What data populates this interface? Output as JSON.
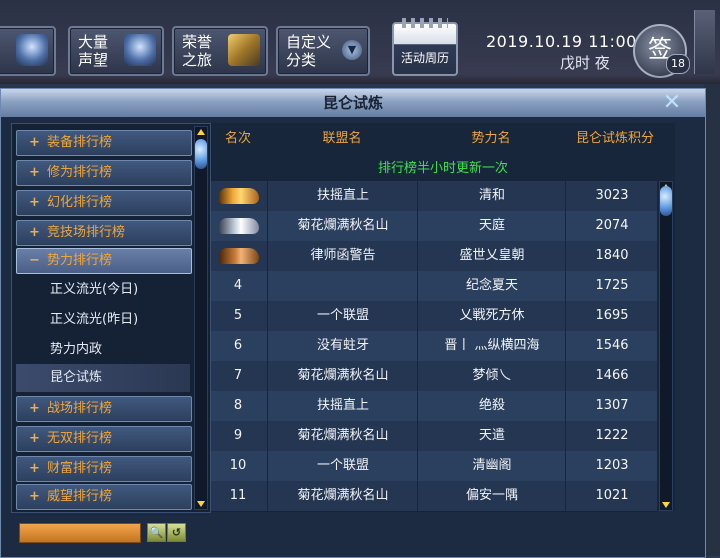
{
  "hud": {
    "buttons": [
      {
        "label": "大量\n声望",
        "icon": "reputation-icon"
      },
      {
        "label": "荣誉\n之旅",
        "icon": "honor-journey-icon"
      },
      {
        "label": "自定义\n分类",
        "icon": "dropdown-icon"
      }
    ],
    "calendar_label": "活动周历",
    "datetime": "2019.10.19  11:00",
    "shichen": "戊时  夜",
    "sign_label": "签",
    "sign_badge": "18"
  },
  "window": {
    "title": "昆仑试炼",
    "notice": "排行榜半小时更新一次"
  },
  "sidebar": {
    "categories_top": [
      {
        "sign": "+",
        "label": "装备排行榜"
      },
      {
        "sign": "+",
        "label": "修为排行榜"
      },
      {
        "sign": "+",
        "label": "幻化排行榜"
      },
      {
        "sign": "+",
        "label": "竞技场排行榜"
      },
      {
        "sign": "−",
        "label": "势力排行榜"
      }
    ],
    "subitems": [
      {
        "label": "正义流光(今日)"
      },
      {
        "label": "正义流光(昨日)"
      },
      {
        "label": "势力内政"
      },
      {
        "label": "昆仑试炼"
      }
    ],
    "categories_bottom": [
      {
        "sign": "+",
        "label": "战场排行榜"
      },
      {
        "sign": "+",
        "label": "无双排行榜"
      },
      {
        "sign": "+",
        "label": "财富排行榜"
      },
      {
        "sign": "+",
        "label": "威望排行榜"
      }
    ]
  },
  "table": {
    "headers": [
      "名次",
      "联盟名",
      "势力名",
      "昆仑试炼积分"
    ],
    "rows": [
      {
        "rank": "",
        "rank_icon": "gold",
        "alliance": "扶摇直上",
        "faction": "清和",
        "score": "3023"
      },
      {
        "rank": "",
        "rank_icon": "silver",
        "alliance": "菊花爛满秋名山",
        "faction": "天庭",
        "score": "2074"
      },
      {
        "rank": "",
        "rank_icon": "bronze",
        "alliance": "律师函警告",
        "faction": "盛世乂皇朝",
        "score": "1840"
      },
      {
        "rank": "4",
        "rank_icon": "",
        "alliance": "",
        "faction": "纪念夏天",
        "score": "1725"
      },
      {
        "rank": "5",
        "rank_icon": "",
        "alliance": "一个联盟",
        "faction": "乂戦死方休",
        "score": "1695"
      },
      {
        "rank": "6",
        "rank_icon": "",
        "alliance": "没有蛀牙",
        "faction": "晋丨 灬纵横四海",
        "score": "1546"
      },
      {
        "rank": "7",
        "rank_icon": "",
        "alliance": "菊花爛满秋名山",
        "faction": "梦倾乀",
        "score": "1466"
      },
      {
        "rank": "8",
        "rank_icon": "",
        "alliance": "扶摇直上",
        "faction": "绝殺",
        "score": "1307"
      },
      {
        "rank": "9",
        "rank_icon": "",
        "alliance": "菊花爛满秋名山",
        "faction": "天遣",
        "score": "1222"
      },
      {
        "rank": "10",
        "rank_icon": "",
        "alliance": "一个联盟",
        "faction": "清幽阁",
        "score": "1203"
      },
      {
        "rank": "11",
        "rank_icon": "",
        "alliance": "菊花爛满秋名山",
        "faction": "偏安一隅",
        "score": "1021"
      }
    ]
  },
  "footer": {
    "search_value": "",
    "search_button": "🔍",
    "reset_button": "↺"
  }
}
